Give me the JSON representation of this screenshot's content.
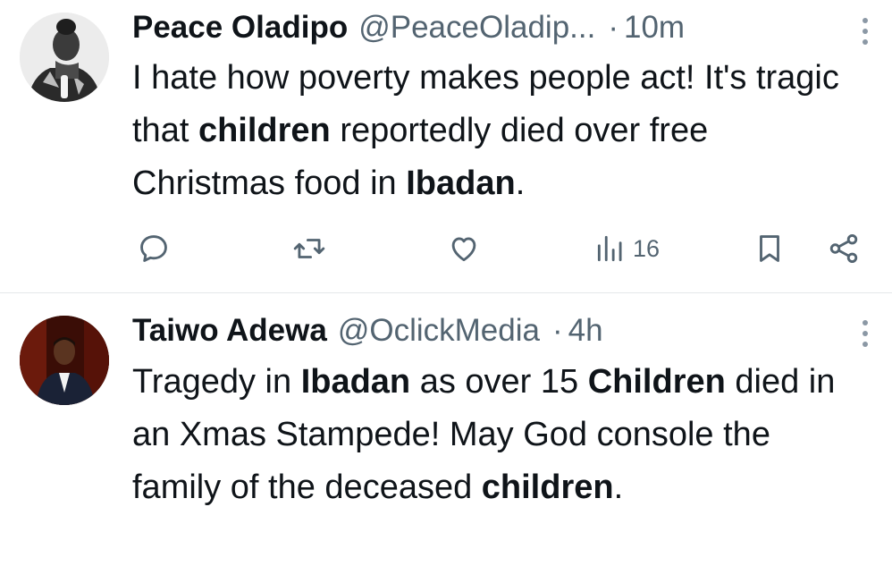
{
  "tweets": [
    {
      "name": "Peace Oladipo",
      "handle": "@PeaceOladip...",
      "separator": "·",
      "time": "10m",
      "text_parts": [
        {
          "t": "I hate how poverty makes people act! It's tragic that ",
          "b": false
        },
        {
          "t": "children",
          "b": true
        },
        {
          "t": " reportedly died over free Christmas food in ",
          "b": false
        },
        {
          "t": "Ibadan",
          "b": true
        },
        {
          "t": ".",
          "b": false
        }
      ],
      "actions": {
        "reply_icon": "reply-icon",
        "retweet_icon": "retweet-icon",
        "like_icon": "like-icon",
        "views_icon": "views-icon",
        "views_count": "16",
        "bookmark_icon": "bookmark-icon",
        "share_icon": "share-icon"
      }
    },
    {
      "name": "Taiwo Adewa",
      "handle": "@OclickMedia",
      "separator": "·",
      "time": "4h",
      "text_parts": [
        {
          "t": "Tragedy in ",
          "b": false
        },
        {
          "t": "Ibadan",
          "b": true
        },
        {
          "t": " as over 15 ",
          "b": false
        },
        {
          "t": "Children",
          "b": true
        },
        {
          "t": " died in an Xmas Stampede! May God console the family of the deceased ",
          "b": false
        },
        {
          "t": "children",
          "b": true
        },
        {
          "t": ".",
          "b": false
        }
      ]
    }
  ],
  "colors": {
    "text": "#0f1419",
    "secondary": "#536471",
    "divider": "#e4e7ea"
  }
}
